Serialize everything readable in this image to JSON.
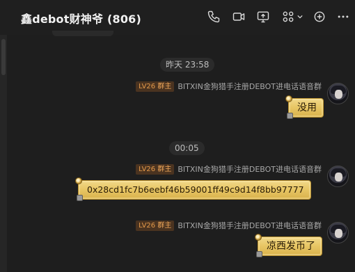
{
  "header": {
    "title": "鑫debot财神爷 (806)",
    "icons": [
      "phone-icon",
      "video-icon",
      "screen-share-icon",
      "apps-grid-icon",
      "add-circle-icon",
      "more-icon"
    ]
  },
  "messages": [
    {
      "time": "昨天 23:58",
      "level": "LV26",
      "role": "群主",
      "sender": "BITXIN金狗猎手注册DEBOT进电话语音群",
      "text": "没用"
    },
    {
      "time": "00:05",
      "level": "LV26",
      "role": "群主",
      "sender": "BITXIN金狗猎手注册DEBOT进电话语音群",
      "text": "0x28cd1fc7b6eebf46b59001ff49c9d14f8bb97777"
    },
    {
      "level": "LV26",
      "role": "群主",
      "sender": "BITXIN金狗猎手注册DEBOT进电话语音群",
      "text": "凉西发币了"
    }
  ],
  "colors": {
    "background": "#1e1e1e",
    "bubble_gold": "#e8c766",
    "badge_bg": "#4a3320",
    "badge_text": "#e59a4a"
  }
}
